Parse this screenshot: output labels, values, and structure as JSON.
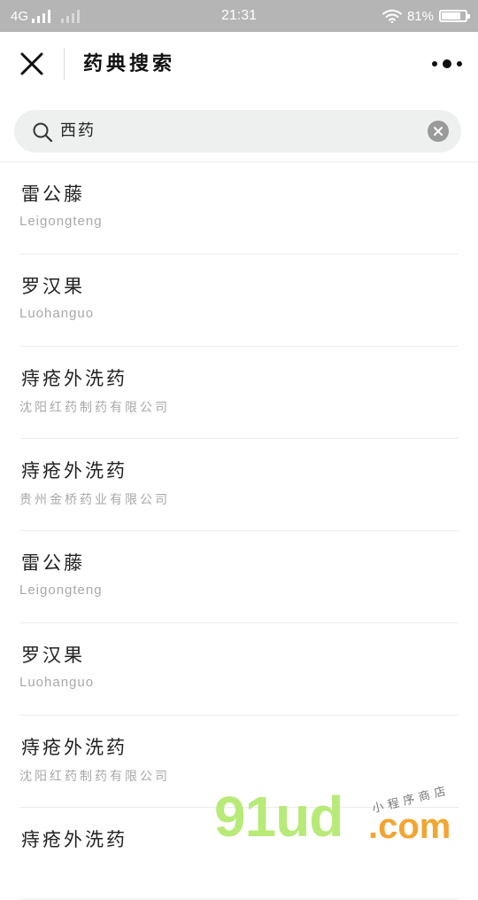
{
  "status_bar": {
    "network": "4G",
    "time": "21:31",
    "battery_text": "81%",
    "battery_level": 0.81
  },
  "nav": {
    "title": "药典搜索"
  },
  "search": {
    "value": "西药"
  },
  "results": [
    {
      "title": "雷公藤",
      "subtitle": "Leigongteng",
      "subtitle_lang": "latin"
    },
    {
      "title": "罗汉果",
      "subtitle": "Luohanguo",
      "subtitle_lang": "latin"
    },
    {
      "title": "痔疮外洗药",
      "subtitle": "沈阳红药制药有限公司",
      "subtitle_lang": "cn"
    },
    {
      "title": "痔疮外洗药",
      "subtitle": "贵州金桥药业有限公司",
      "subtitle_lang": "cn"
    },
    {
      "title": "雷公藤",
      "subtitle": "Leigongteng",
      "subtitle_lang": "latin"
    },
    {
      "title": "罗汉果",
      "subtitle": "Luohanguo",
      "subtitle_lang": "latin"
    },
    {
      "title": "痔疮外洗药",
      "subtitle": "沈阳红药制药有限公司",
      "subtitle_lang": "cn"
    },
    {
      "title": "痔疮外洗药",
      "subtitle": "",
      "subtitle_lang": "cn"
    }
  ],
  "watermark": {
    "brand": "91ud",
    "domain": ".com",
    "tagline": "小程序商店"
  },
  "colors": {
    "status_bar_bg": "#b5b5b5",
    "search_bg": "#eef0f0",
    "subtitle": "#a8a8a8",
    "watermark_green": "#b8ea78",
    "watermark_orange": "#f2a531"
  },
  "icons": {
    "close": "close-icon",
    "more": "more-dots-icon",
    "search": "search-icon",
    "clear": "clear-icon",
    "wifi": "wifi-icon",
    "battery": "battery-icon",
    "signal": "signal-icon"
  }
}
